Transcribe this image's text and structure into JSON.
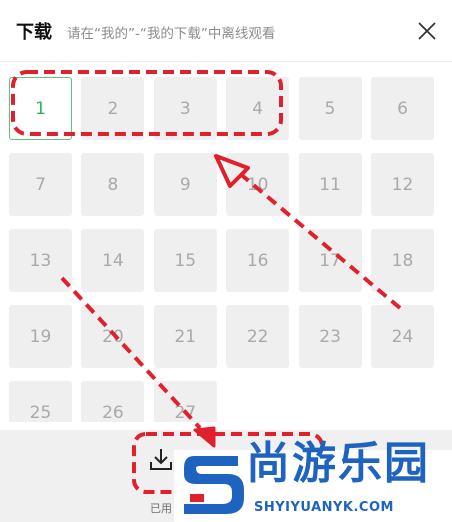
{
  "header": {
    "title": "下载",
    "subtitle": "请在“我的”-“我的下载”中离线观看"
  },
  "episodes": [
    "1",
    "2",
    "3",
    "4",
    "5",
    "6",
    "7",
    "8",
    "9",
    "10",
    "11",
    "12",
    "13",
    "14",
    "15",
    "16",
    "17",
    "18",
    "19",
    "20",
    "21",
    "22",
    "23",
    "24",
    "25",
    "26",
    "27"
  ],
  "active_episode": "1",
  "bottom": {
    "downloaded_label": "已用"
  },
  "watermark": {
    "brand_cn": "尚游乐园",
    "brand_en": "SHYIYUANYK.COM"
  },
  "colors": {
    "accent_green": "#2fb35f",
    "annotation_red": "#e0202c",
    "watermark_blue": "#1f63c0"
  }
}
